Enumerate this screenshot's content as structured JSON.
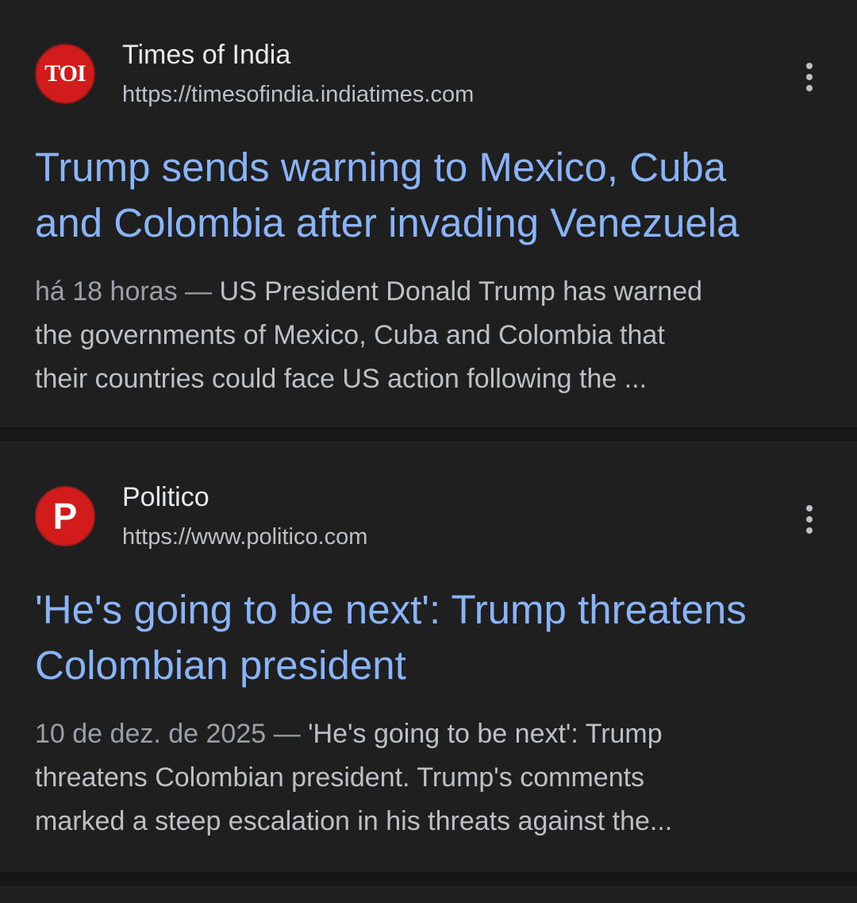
{
  "results": [
    {
      "source_name": "Times of India",
      "url": "https://timesofindia.indiatimes.com",
      "favicon_text": "TOI",
      "title_line1": "Trump sends warning to Mexico, Cuba",
      "title_line2": "and Colombia after invading Venezuela",
      "date": "há 18 horas",
      "separator": "—",
      "snippet_line1": "US President Donald Trump has warned",
      "snippet_line2": "the governments of Mexico, Cuba and Colombia that",
      "snippet_line3": "their countries could face US action following the ..."
    },
    {
      "source_name": "Politico",
      "url": "https://www.politico.com",
      "favicon_text": "P",
      "title_line1": "'He's going to be next': Trump threatens",
      "title_line2": "Colombian president",
      "date": "10 de dez. de 2025",
      "separator": "—",
      "snippet_line1": "'He's going to be next': Trump",
      "snippet_line2": "threatens Colombian president. Trump's comments",
      "snippet_line3": "marked a steep escalation in his threats against the..."
    }
  ],
  "colors": {
    "background": "#1f1f1f",
    "title_link": "#8ab4f8",
    "text": "#bdc1c6",
    "favicon_red": "#d21b1b"
  },
  "icons": {
    "menu": "more-vert-icon"
  }
}
